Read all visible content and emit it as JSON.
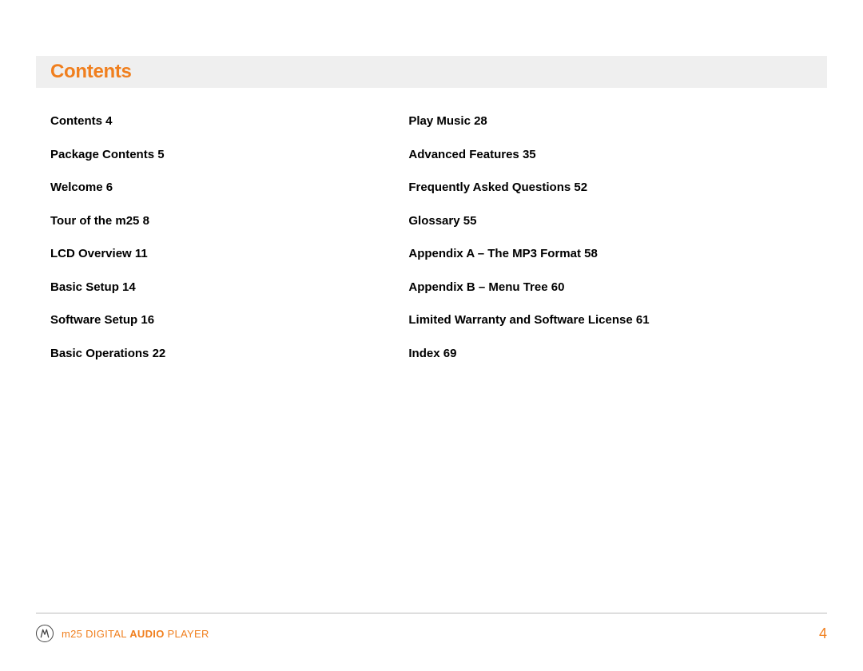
{
  "title": "Contents",
  "toc": {
    "left": [
      {
        "label": "Contents",
        "page": "4"
      },
      {
        "label": "Package Contents",
        "page": "5"
      },
      {
        "label": "Welcome",
        "page": "6"
      },
      {
        "label": "Tour of the m25",
        "page": "8"
      },
      {
        "label": "LCD Overview",
        "page": "11"
      },
      {
        "label": "Basic Setup",
        "page": "14"
      },
      {
        "label": "Software Setup",
        "page": "16"
      },
      {
        "label": "Basic Operations",
        "page": "22"
      }
    ],
    "right": [
      {
        "label": "Play Music",
        "page": "28"
      },
      {
        "label": "Advanced Features",
        "page": "35"
      },
      {
        "label": "Frequently Asked Questions",
        "page": "52"
      },
      {
        "label": "Glossary",
        "page": "55"
      },
      {
        "label": "Appendix A – The MP3 Format",
        "page": "58"
      },
      {
        "label": "Appendix B – Menu Tree",
        "page": "60"
      },
      {
        "label": "Limited Warranty and Software License",
        "page": "61"
      },
      {
        "label": "Index",
        "page": "69"
      }
    ]
  },
  "footer": {
    "product_prefix": "m25 DIGITAL ",
    "product_bold": "AUDIO",
    "product_suffix": " PLAYER"
  },
  "page_number": "4"
}
